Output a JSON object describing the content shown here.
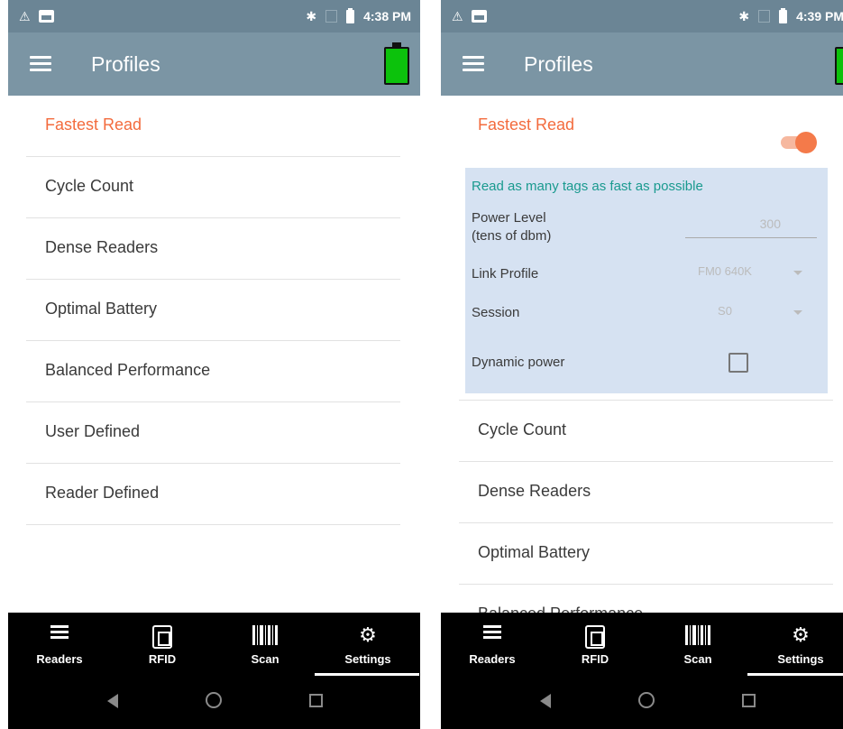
{
  "screens": [
    {
      "status": {
        "time": "4:38 PM"
      },
      "appbar": {
        "title": "Profiles"
      },
      "profiles": [
        {
          "label": "Fastest Read",
          "active": true
        },
        {
          "label": "Cycle Count"
        },
        {
          "label": "Dense Readers"
        },
        {
          "label": "Optimal Battery"
        },
        {
          "label": "Balanced Performance"
        },
        {
          "label": "User Defined"
        },
        {
          "label": "Reader Defined"
        }
      ],
      "nav": [
        {
          "label": "Readers",
          "icon": "list-icon"
        },
        {
          "label": "RFID",
          "icon": "rfid-icon"
        },
        {
          "label": "Scan",
          "icon": "barcode-icon"
        },
        {
          "label": "Settings",
          "icon": "gear-icon",
          "active": true
        }
      ]
    },
    {
      "status": {
        "time": "4:39 PM"
      },
      "appbar": {
        "title": "Profiles"
      },
      "profiles": [
        {
          "label": "Fastest Read",
          "active": true,
          "toggle_on": true
        },
        {
          "label": "Cycle Count"
        },
        {
          "label": "Dense Readers"
        },
        {
          "label": "Optimal Battery"
        },
        {
          "label": "Balanced Performance"
        }
      ],
      "details": {
        "description": "Read as many tags as fast as possible",
        "power_level_label_1": "Power Level",
        "power_level_label_2": "(tens of dbm)",
        "power_level_value": "300",
        "link_profile_label": "Link Profile",
        "link_profile_value": "FM0 640K",
        "session_label": "Session",
        "session_value": "S0",
        "dynamic_power_label": "Dynamic power",
        "dynamic_power_checked": false
      },
      "nav": [
        {
          "label": "Readers",
          "icon": "list-icon"
        },
        {
          "label": "RFID",
          "icon": "rfid-icon"
        },
        {
          "label": "Scan",
          "icon": "barcode-icon"
        },
        {
          "label": "Settings",
          "icon": "gear-icon",
          "active": true
        }
      ]
    }
  ],
  "colors": {
    "statusbar": "#6b8595",
    "appbar": "#7b95a4",
    "active_text": "#f36b3d",
    "details_bg": "#d6e2f2",
    "description_text": "#1a9a8f",
    "battery_green": "#0cc20c"
  }
}
